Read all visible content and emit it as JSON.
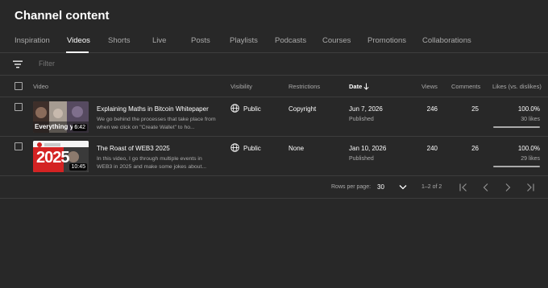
{
  "header": {
    "title": "Channel content"
  },
  "tabs": [
    {
      "label": "Inspiration"
    },
    {
      "label": "Videos"
    },
    {
      "label": "Shorts"
    },
    {
      "label": "Live"
    },
    {
      "label": "Posts"
    },
    {
      "label": "Playlists"
    },
    {
      "label": "Podcasts"
    },
    {
      "label": "Courses"
    },
    {
      "label": "Promotions"
    },
    {
      "label": "Collaborations"
    }
  ],
  "active_tab": "Videos",
  "filter": {
    "placeholder": "Filter",
    "icon": "filter-icon"
  },
  "columns": {
    "video": "Video",
    "visibility": "Visibility",
    "restrictions": "Restrictions",
    "date": "Date",
    "views": "Views",
    "comments": "Comments",
    "likes": "Likes (vs. dislikes)"
  },
  "sort": {
    "column": "Date",
    "direction": "descending"
  },
  "videos": [
    {
      "title": "Explaining Maths in Bitcoin Whitepaper",
      "description": "We go behind the processes that take place from when we click on \"Create Wallet\" to ho...",
      "thumbnail_text": "Everything you",
      "duration": "6:42",
      "visibility": "Public",
      "restrictions": "Copyright",
      "date": "Jun 7, 2026",
      "status": "Published",
      "views": "246",
      "comments": "25",
      "likes_pct": "100.0%",
      "likes_count": "30 likes",
      "likes_ratio": 1.0
    },
    {
      "title": "The Roast of WEB3 2025",
      "description": "In this video, I go through multiple events in WEB3 in 2025 and make some jokes about...",
      "thumbnail_text": "2025",
      "duration": "10:45",
      "visibility": "Public",
      "restrictions": "None",
      "date": "Jan 10, 2026",
      "status": "Published",
      "views": "240",
      "comments": "26",
      "likes_pct": "100.0%",
      "likes_count": "29 likes",
      "likes_ratio": 1.0
    }
  ],
  "pagination": {
    "rows_per_page_label": "Rows per page:",
    "rows_per_page": "30",
    "range": "1–2 of 2"
  },
  "colors": {
    "background": "#282828",
    "text": "#ffffff",
    "muted": "#aaaaaa",
    "divider": "#3d3d3d"
  }
}
